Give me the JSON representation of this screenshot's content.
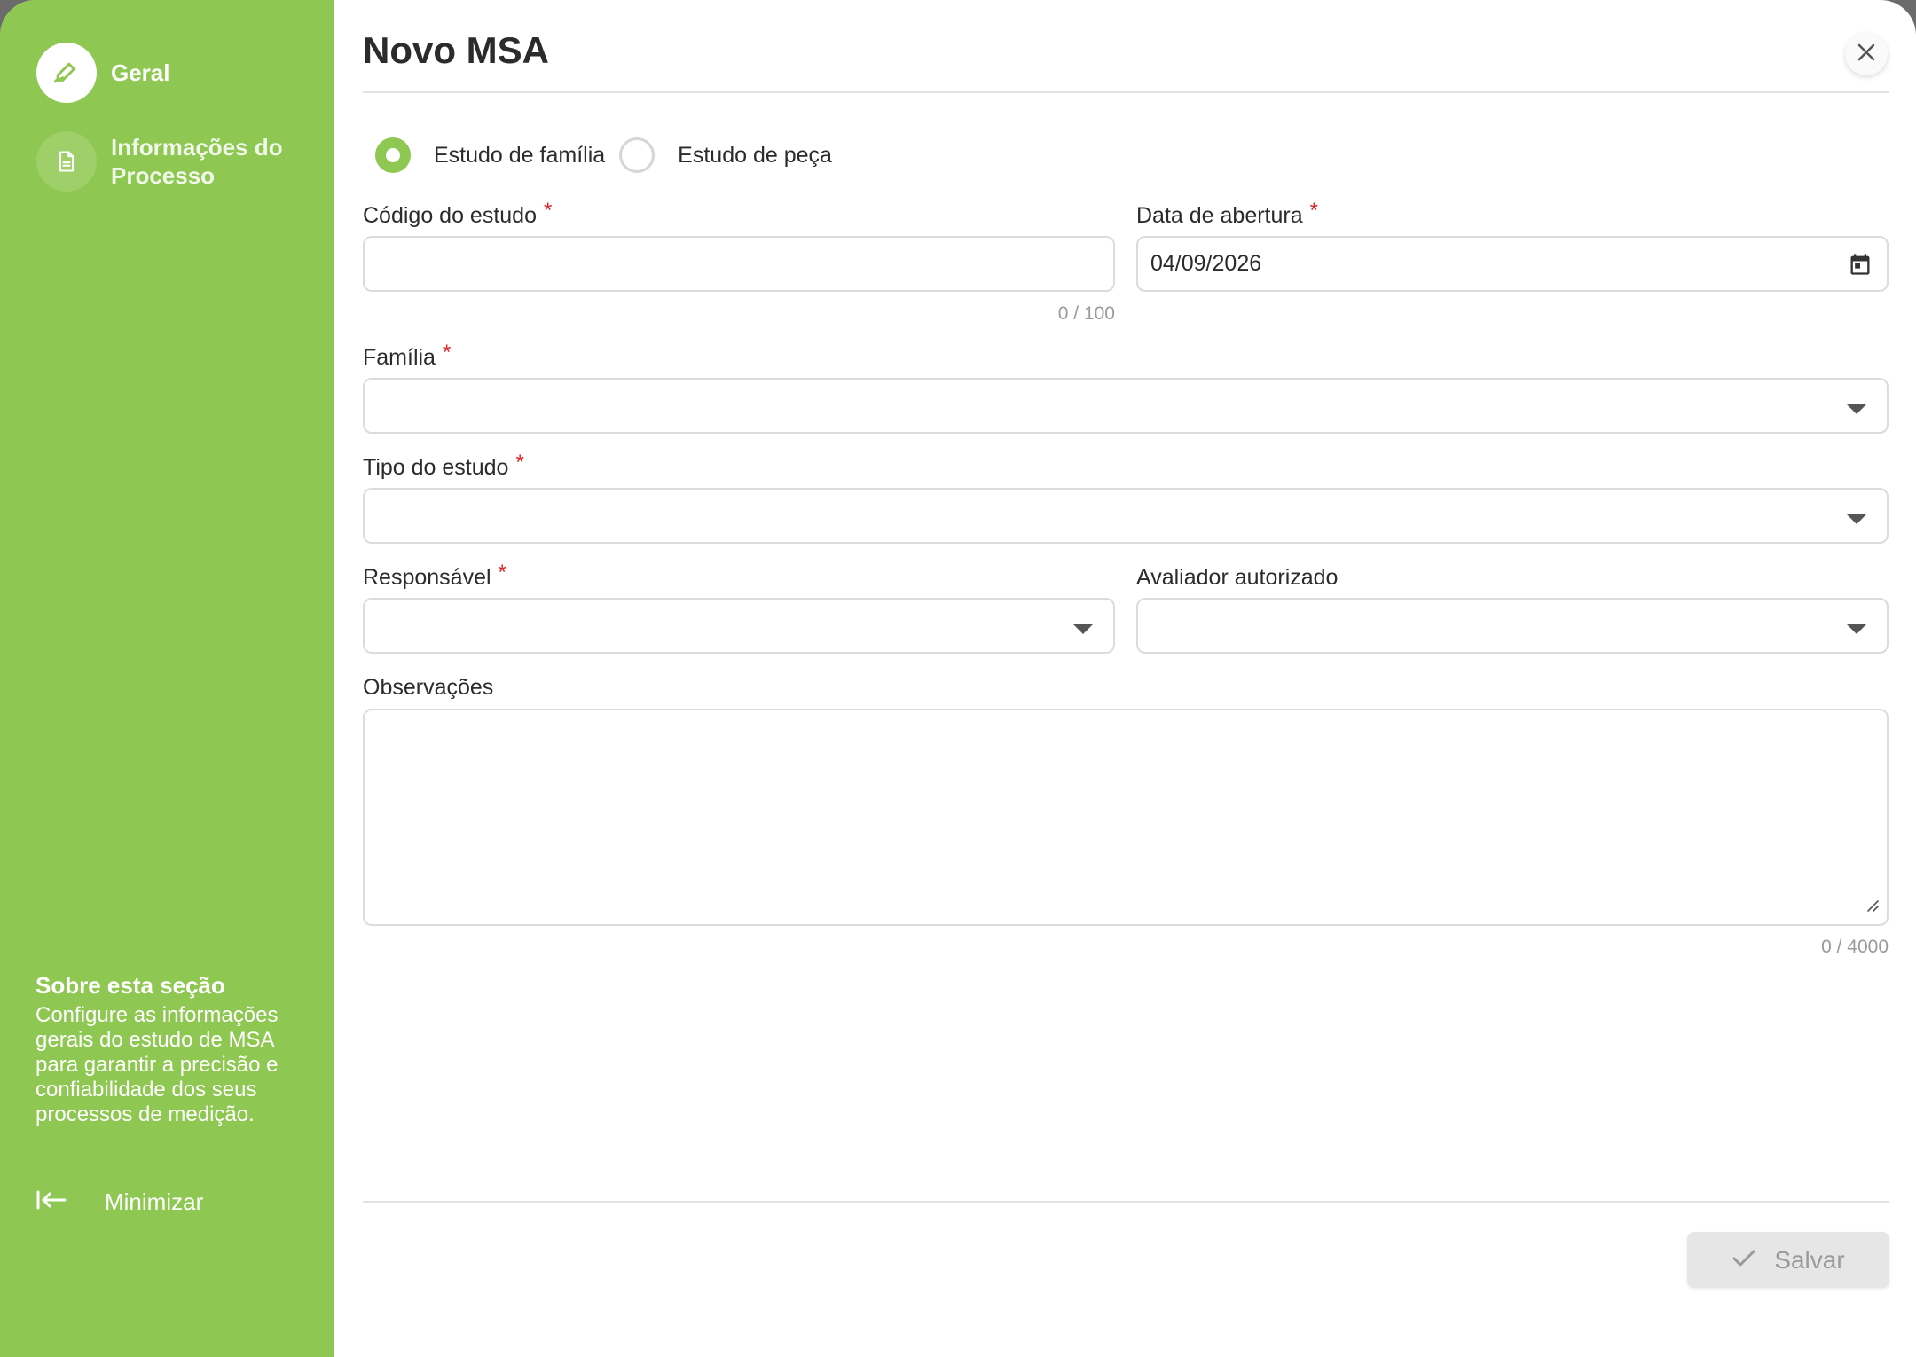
{
  "modal": {
    "title": "Novo MSA",
    "close_icon": "close-icon"
  },
  "sidebar": {
    "steps": [
      {
        "label": "Geral",
        "icon": "pencil-icon",
        "active": true
      },
      {
        "label": "Informações do Processo",
        "icon": "document-icon",
        "active": false
      }
    ],
    "about": {
      "title": "Sobre esta seção",
      "text": "Configure as informações gerais do estudo de MSA para garantir a precisão e confiabilidade dos seus processos de medição."
    },
    "minimize_label": "Minimizar",
    "colors": {
      "background": "#8ec751",
      "text": "#ffffff"
    }
  },
  "form": {
    "study_kind": {
      "options": [
        {
          "label": "Estudo de família",
          "checked": true
        },
        {
          "label": "Estudo de peça",
          "checked": false
        }
      ]
    },
    "codigo": {
      "label": "Código do estudo",
      "required_mark": "*",
      "value": "",
      "counter": "0 / 100"
    },
    "data_abertura": {
      "label": "Data de abertura",
      "required_mark": "*",
      "value": "04/09/2026"
    },
    "familia": {
      "label": "Família",
      "required_mark": "*",
      "value": ""
    },
    "tipo": {
      "label": "Tipo do estudo",
      "required_mark": "*",
      "value": ""
    },
    "responsavel": {
      "label": "Responsável",
      "required_mark": "*",
      "value": ""
    },
    "avaliador": {
      "label": "Avaliador autorizado",
      "value": ""
    },
    "observacoes": {
      "label": "Observações",
      "value": "",
      "counter": "0 / 4000"
    }
  },
  "footer": {
    "save_label": "Salvar",
    "save_enabled": false
  },
  "colors": {
    "accent": "#8ec751",
    "required": "#e02424",
    "disabled_bg": "#e6e6e6"
  }
}
